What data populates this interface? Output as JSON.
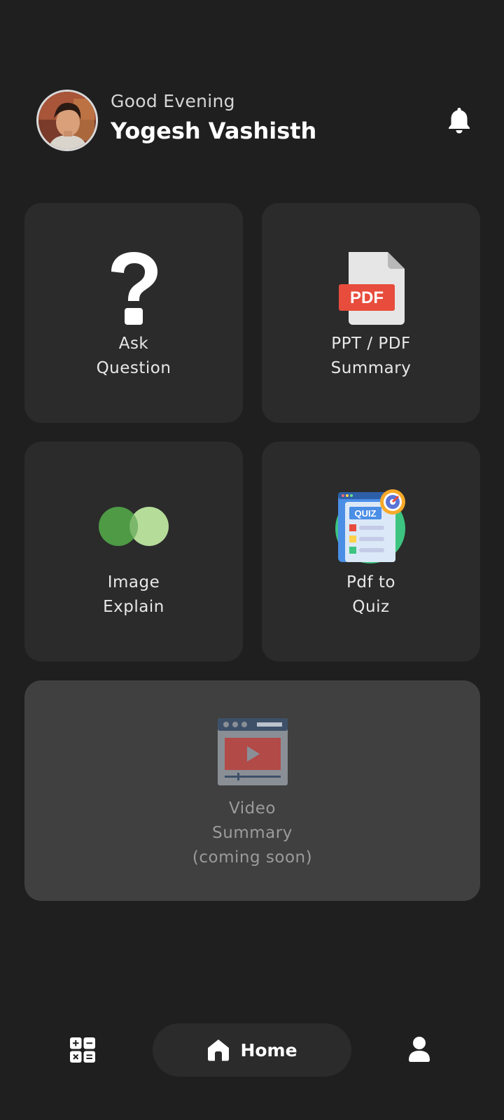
{
  "header": {
    "greeting": "Good Evening",
    "user_name": "Yogesh Vashisth",
    "avatar_icon": "user-avatar-photo",
    "notification_icon": "bell-icon"
  },
  "cards": {
    "ask": {
      "line1": "Ask",
      "line2": "Question",
      "icon": "question-mark-icon"
    },
    "pdf": {
      "line1": "PPT / PDF",
      "line2": "Summary",
      "icon": "pdf-file-icon",
      "badge": "PDF"
    },
    "image": {
      "line1": "Image",
      "line2": "Explain",
      "icon": "overlapping-circles-icon"
    },
    "quiz": {
      "line1": "Pdf to",
      "line2": "Quiz",
      "icon": "quiz-icon",
      "badge": "QUIZ"
    },
    "video": {
      "line1": "Video",
      "line2": "Summary",
      "line3": "(coming soon)",
      "icon": "video-player-icon"
    }
  },
  "bottom_nav": {
    "home_label": "Home",
    "calculator_icon": "calculator-icon",
    "home_icon": "home-icon",
    "profile_icon": "profile-icon"
  },
  "colors": {
    "background": "#1f1f1f",
    "card": "#2b2b2b",
    "card_disabled": "#404040",
    "pdf_red": "#e74c3c",
    "image_dark_green": "#4e9a45",
    "image_light_green": "#b5dc99"
  }
}
